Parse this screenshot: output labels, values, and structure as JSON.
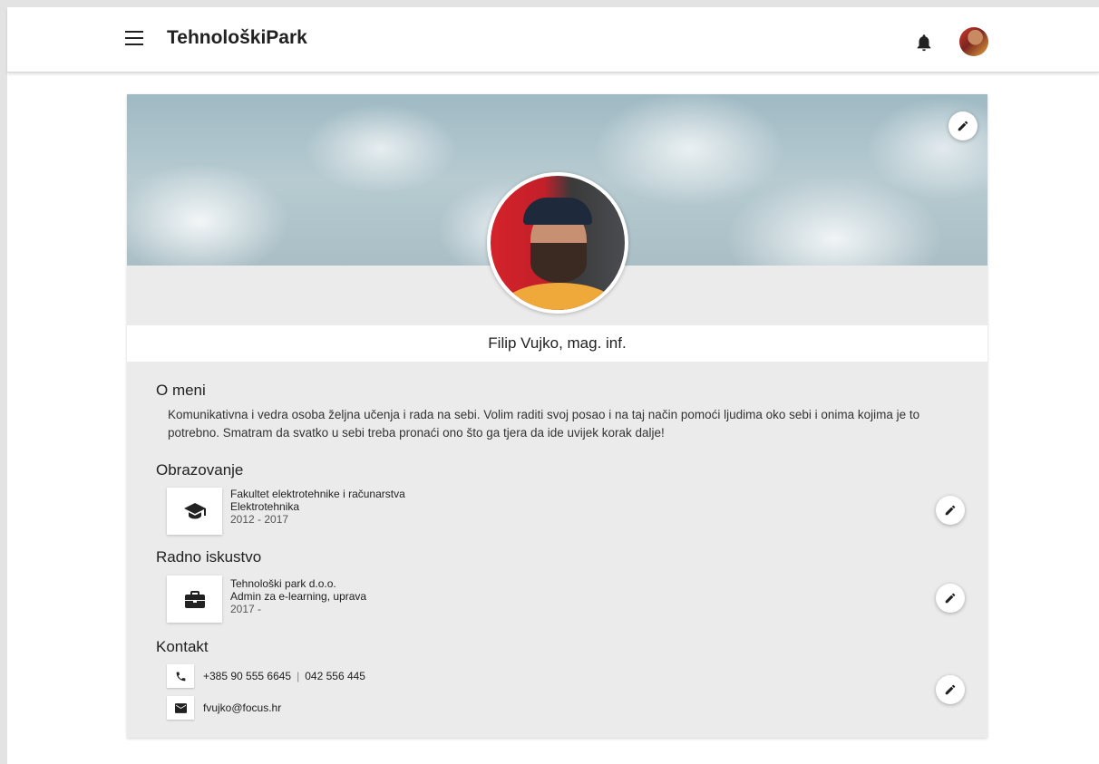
{
  "header": {
    "app_title": "TehnološkiPark",
    "menu_icon": "menu-icon",
    "notification_icon": "bell-icon",
    "avatar_icon": "avatar"
  },
  "profile": {
    "name": "Filip Vujko, mag. inf.",
    "cover_edit_icon": "pencil-icon"
  },
  "about": {
    "title": "O meni",
    "text": "Komunikativna i vedra osoba željna učenja i rada na sebi. Volim raditi svoj posao i na taj način pomoći ljudima oko sebi i onima kojima je to potrebno. Smatram da svatko u sebi treba pronaći ono što ga tjera da ide uvijek korak dalje!"
  },
  "education": {
    "title": "Obrazovanje",
    "icon": "graduation-cap-icon",
    "institution": "Fakultet elektrotehnike i računarstva",
    "field": "Elektrotehnika",
    "years": "2012 - 2017"
  },
  "experience": {
    "title": "Radno iskustvo",
    "icon": "briefcase-icon",
    "company": "Tehnološki park d.o.o.",
    "role": "Admin za e-learning, uprava",
    "years": "2017 -"
  },
  "contact": {
    "title": "Kontakt",
    "phone_icon": "phone-icon",
    "phone_mobile": "+385 90 555 6645",
    "phone_separator": "|",
    "phone_landline": "042 556 445",
    "email_icon": "email-icon",
    "email": "fvujko@focus.hr"
  },
  "colors": {
    "background": "#ebebeb",
    "card": "#ffffff",
    "text": "#212121"
  }
}
